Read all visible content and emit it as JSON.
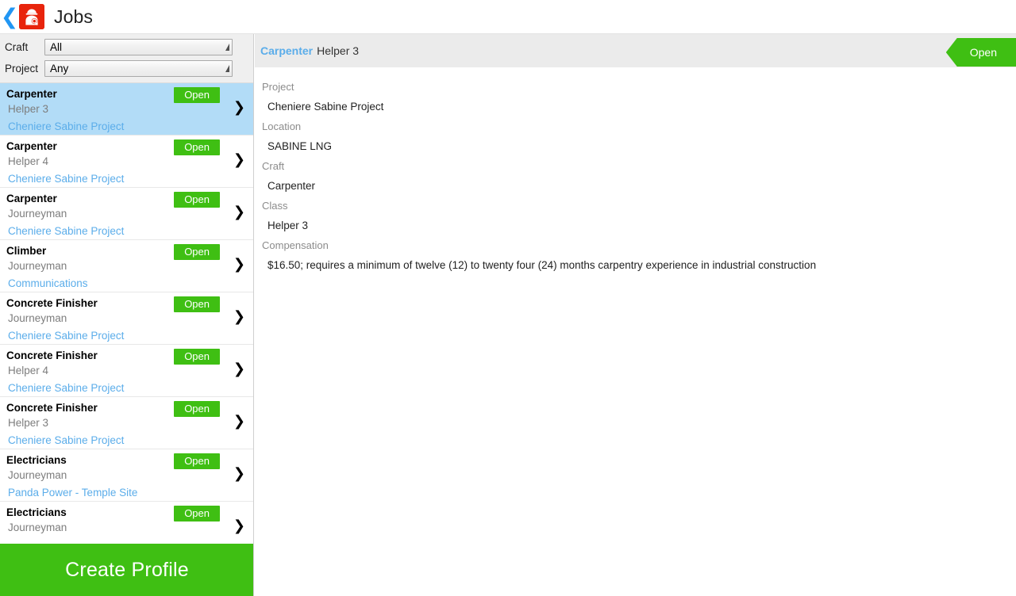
{
  "header": {
    "back_icon": "back-chevron-icon",
    "app_icon": "worker-search-icon",
    "title": "Jobs"
  },
  "filters": [
    {
      "label": "Craft",
      "value": "All",
      "arrow_icon": "dropdown-triangle-icon"
    },
    {
      "label": "Project",
      "value": "Any",
      "arrow_icon": "dropdown-triangle-icon"
    }
  ],
  "job_list": {
    "rows": [
      {
        "craft": "Carpenter",
        "class": "Helper 3",
        "project": "Cheniere Sabine Project",
        "status": "Open",
        "selected": true
      },
      {
        "craft": "Carpenter",
        "class": "Helper 4",
        "project": "Cheniere Sabine Project",
        "status": "Open",
        "selected": false
      },
      {
        "craft": "Carpenter",
        "class": "Journeyman",
        "project": "Cheniere Sabine Project",
        "status": "Open",
        "selected": false
      },
      {
        "craft": "Climber",
        "class": "Journeyman",
        "project": "Communications",
        "status": "Open",
        "selected": false
      },
      {
        "craft": "Concrete Finisher",
        "class": "Journeyman",
        "project": "Cheniere Sabine Project",
        "status": "Open",
        "selected": false
      },
      {
        "craft": "Concrete Finisher",
        "class": "Helper 4",
        "project": "Cheniere Sabine Project",
        "status": "Open",
        "selected": false
      },
      {
        "craft": "Concrete Finisher",
        "class": "Helper 3",
        "project": "Cheniere Sabine Project",
        "status": "Open",
        "selected": false
      },
      {
        "craft": "Electricians",
        "class": "Journeyman",
        "project": "Panda Power - Temple Site",
        "status": "Open",
        "selected": false
      },
      {
        "craft": "Electricians",
        "class": "Journeyman",
        "project": "",
        "status": "Open",
        "selected": false
      }
    ]
  },
  "create_profile": {
    "label": "Create Profile"
  },
  "detail": {
    "craft": "Carpenter",
    "class": "Helper 3",
    "status": "Open",
    "fields": [
      {
        "label": "Project",
        "value": "Cheniere Sabine Project"
      },
      {
        "label": "Location",
        "value": "SABINE LNG"
      },
      {
        "label": "Craft",
        "value": "Carpenter"
      },
      {
        "label": "Class",
        "value": "Helper 3"
      },
      {
        "label": "Compensation",
        "value": "$16.50; requires a minimum of twelve (12) to twenty four (24) months carpentry experience in industrial construction"
      }
    ]
  },
  "colors": {
    "accent_green": "#3fbf13",
    "link_blue": "#5badea",
    "selected_row": "#b2dcf7",
    "app_icon_red": "#e8240c"
  }
}
